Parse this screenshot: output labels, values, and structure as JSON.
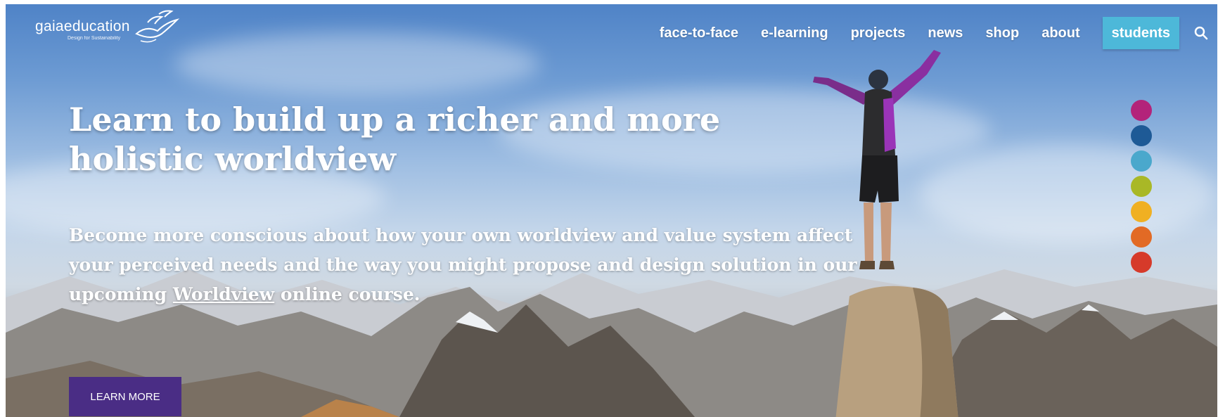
{
  "logo": {
    "name": "gaiaeducation",
    "tagline": "Design for Sustainability"
  },
  "nav": {
    "items": [
      {
        "label": "face-to-face"
      },
      {
        "label": "e-learning"
      },
      {
        "label": "projects"
      },
      {
        "label": "news"
      },
      {
        "label": "shop"
      },
      {
        "label": "about"
      }
    ],
    "students_label": "students",
    "search_icon": "search-icon"
  },
  "hero": {
    "headline_line1": "Learn to build up a richer and more",
    "headline_line2": "holistic worldview",
    "sub_before": "Become more conscious about how your own worldview and value system affect your perceived needs and the way you might propose and design solution in our upcoming ",
    "sub_link": "Worldview",
    "sub_after": " online course.",
    "cta_label": "LEARN MORE"
  },
  "colors": {
    "cta": "#4a2d85",
    "students": "#4db8d9",
    "dots": [
      "#b3237a",
      "#1e5a96",
      "#4aa8cc",
      "#a9b826",
      "#f0b022",
      "#e26a25",
      "#d63a2a"
    ]
  }
}
